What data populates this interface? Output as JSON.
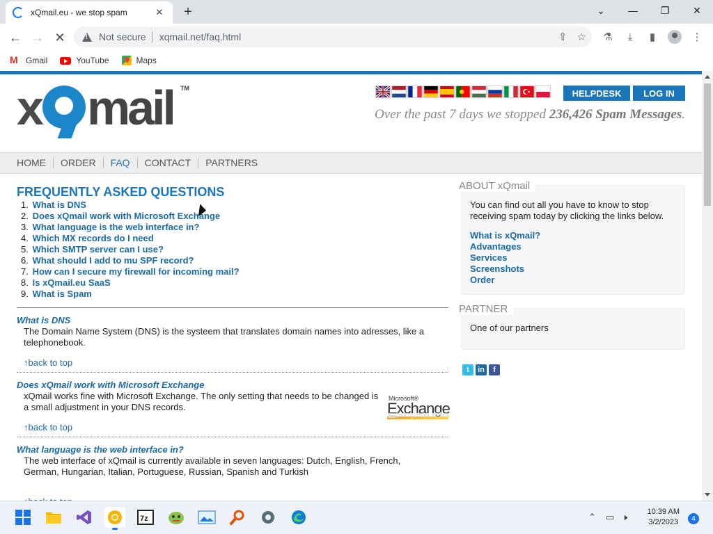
{
  "browser": {
    "tab_title": "xQmail.eu - we stop spam",
    "new_tab": "+",
    "close_tab": "✕",
    "not_secure": "Not secure",
    "url": "xqmail.net/faq.html",
    "bookmarks": [
      {
        "label": "Gmail",
        "icon": "gmail-icon"
      },
      {
        "label": "YouTube",
        "icon": "youtube-icon"
      },
      {
        "label": "Maps",
        "icon": "maps-icon"
      }
    ]
  },
  "header": {
    "logo_text": "xQmail",
    "logo_tm": "TM",
    "flags": [
      "en",
      "nl",
      "fr",
      "de",
      "es",
      "pt",
      "hu",
      "ru",
      "it",
      "tr",
      "pl"
    ],
    "helpdesk": "HELPDESK",
    "login": "LOG IN",
    "stopped_prefix": "Over the past 7 days we stopped",
    "stopped_count": "236,426 Spam Messages",
    "stopped_suffix": "."
  },
  "nav": {
    "items": [
      "HOME",
      "ORDER",
      "FAQ",
      "CONTACT",
      "PARTNERS"
    ],
    "active": "FAQ"
  },
  "faq": {
    "title": "FREQUENTLY ASKED QUESTIONS",
    "questions": [
      {
        "num": "1.",
        "text": "What is DNS"
      },
      {
        "num": "2.",
        "text": "Does xQmail work with Microsoft Exchange"
      },
      {
        "num": "3.",
        "text": "What language is the web interface in?"
      },
      {
        "num": "4.",
        "text": "Which MX records do I need"
      },
      {
        "num": "5.",
        "text": "Which SMTP server can I use?"
      },
      {
        "num": "6.",
        "text": "What should I add to mu SPF record?"
      },
      {
        "num": "7.",
        "text": "How can I secure my firewall for incoming mail?"
      },
      {
        "num": "8.",
        "text": "Is xQmail.eu SaaS"
      },
      {
        "num": "9.",
        "text": "What is Spam"
      }
    ],
    "answers": [
      {
        "q": "What is DNS",
        "a": "The Domain Name System (DNS) is the systeem that translates domain names into adresses, like a telephonebook."
      },
      {
        "q": "Does xQmail work with Microsoft Exchange",
        "a": "xQmail works fine with Microsoft Exchange. The only setting that needs to be changed is a small adjustment in your DNS records."
      },
      {
        "q": "What language is the web interface in?",
        "a": "The web interface of xQmail is currently available in seven languages: Dutch, English, French, German, Hungarian, Italian, Portuguese, Russian, Spanish and Turkish"
      }
    ],
    "back_to_top": "↑back to top",
    "exchange_ms": "Microsoft®",
    "exchange_name": "Exchange"
  },
  "sidebar": {
    "about_title": "ABOUT xQmail",
    "about_text": "You can find out all you have to know to stop receiving spam today by clicking the links below.",
    "about_links": [
      "What is xQmail?",
      "Advantages",
      "Services",
      "Screenshots",
      "Order"
    ],
    "partner_title": "PARTNER",
    "partner_text": "One of our partners"
  },
  "taskbar": {
    "time": "10:39 AM",
    "date": "3/2/2023",
    "notifications": "4"
  }
}
